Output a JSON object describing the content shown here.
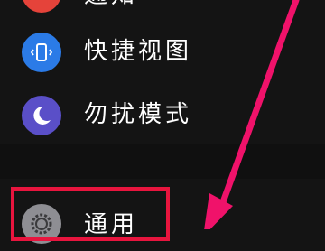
{
  "settings_list": {
    "items": [
      {
        "label": "通知",
        "icon": "bell-icon",
        "color": "#e5433a"
      },
      {
        "label": "快捷视图",
        "icon": "glance-icon",
        "color": "#2b7be7"
      },
      {
        "label": "勿扰模式",
        "icon": "moon-icon",
        "color": "#5a4fc8"
      },
      {
        "label": "通用",
        "icon": "gear-icon",
        "color": "#8e8e93"
      }
    ]
  },
  "annotation": {
    "color": "#e8153e",
    "arrow_color": "#f0126a"
  },
  "background": "#141414"
}
